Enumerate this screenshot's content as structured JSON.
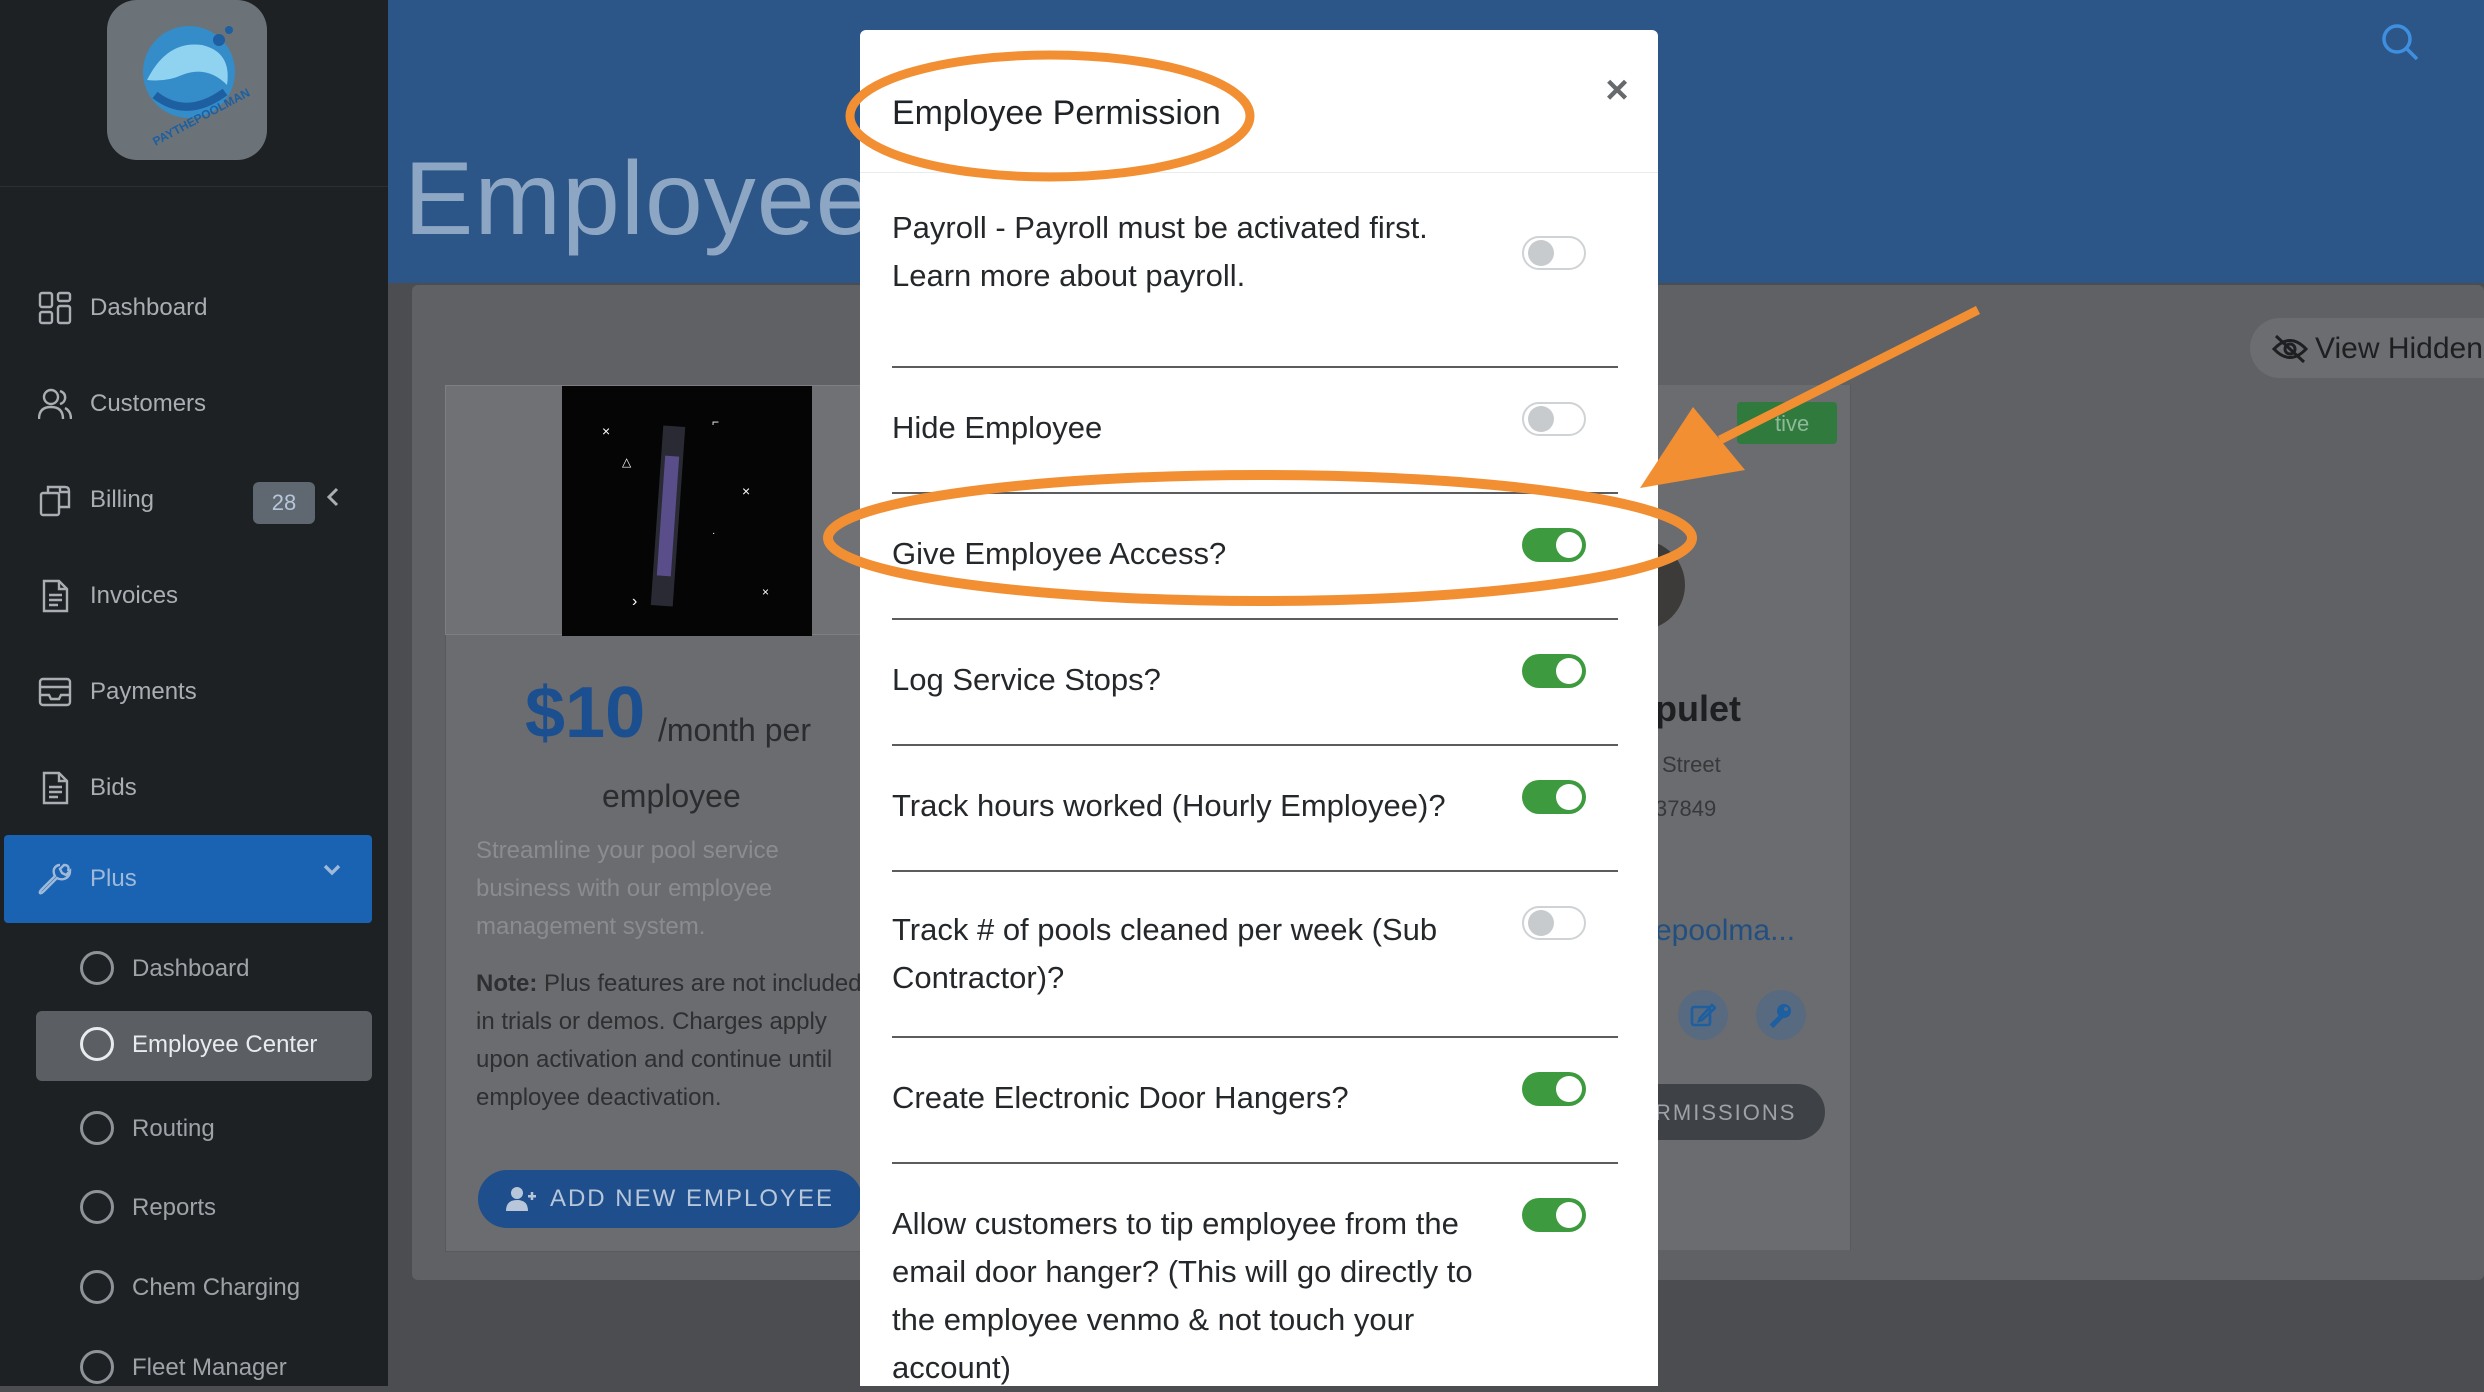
{
  "sidebar": {
    "logo_text": "PAYTHEPOOLMAN",
    "items": [
      {
        "label": "Dashboard",
        "icon": "dashboard-grid-icon"
      },
      {
        "label": "Customers",
        "icon": "customers-icon"
      },
      {
        "label": "Billing",
        "icon": "billing-copy-icon",
        "badge": "28"
      },
      {
        "label": "Invoices",
        "icon": "invoice-doc-icon"
      },
      {
        "label": "Payments",
        "icon": "payments-inbox-icon"
      },
      {
        "label": "Bids",
        "icon": "bids-doc-icon"
      },
      {
        "label": "Plus",
        "icon": "wrench-icon"
      }
    ],
    "plus_subitems": [
      {
        "label": "Dashboard"
      },
      {
        "label": "Employee Center",
        "active": true
      },
      {
        "label": "Routing"
      },
      {
        "label": "Reports"
      },
      {
        "label": "Chem Charging"
      },
      {
        "label": "Fleet Manager"
      }
    ]
  },
  "header": {
    "page_title": "Employee"
  },
  "plan_card": {
    "price": "$10",
    "per_line1": "/month per",
    "per_line2": "employee",
    "description": "Streamline your pool service business with our employee management system.",
    "note_label": "Note:",
    "note_text": " Plus features are not included in trials or demos. Charges apply upon activation and continue until employee deactivation.",
    "add_button": "ADD NEW EMPLOYEE"
  },
  "employee_card": {
    "view_hidden": "View Hidden",
    "status_badge": "tive",
    "name_fragment": "pulet",
    "street_fragment": "Street",
    "zip_fragment": "37849",
    "email_fragment": "epoolma...",
    "permissions_button": "RMISSIONS"
  },
  "modal": {
    "title": "Employee Permission",
    "close_label": "×",
    "permissions": [
      {
        "label": "Payroll - Payroll must be activated first. Learn more about payroll.",
        "enabled": false
      },
      {
        "label": "Hide Employee",
        "enabled": false
      },
      {
        "label": "Give Employee Access?",
        "enabled": true
      },
      {
        "label": "Log Service Stops?",
        "enabled": true
      },
      {
        "label": "Track hours worked (Hourly Employee)?",
        "enabled": true
      },
      {
        "label": "Track # of pools cleaned per week (Sub Contractor)?",
        "enabled": false
      },
      {
        "label": "Create Electronic Door Hangers?",
        "enabled": true
      },
      {
        "label": "Allow customers to tip employee from the email door hanger? (This will go directly to the employee venmo & not touch your account)",
        "enabled": true
      }
    ]
  },
  "colors": {
    "toggle_on": "#3d9a3e",
    "annotation_orange": "#f28f33",
    "sidebar_bg": "#1e2124",
    "plus_active": "#1a63b3"
  }
}
